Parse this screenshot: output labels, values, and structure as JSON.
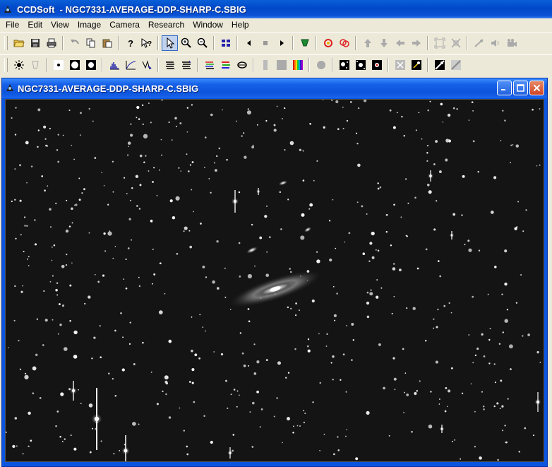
{
  "app": {
    "title": "CCDSoft  - NGC7331-AVERAGE-DDP-SHARP-C.SBIG",
    "icon": "ccdsoft-app-icon"
  },
  "menu": [
    "File",
    "Edit",
    "View",
    "Image",
    "Camera",
    "Research",
    "Window",
    "Help"
  ],
  "toolbar1": [
    {
      "icon": "open-folder-icon"
    },
    {
      "icon": "save-icon"
    },
    {
      "icon": "print-icon"
    },
    {
      "sep": true
    },
    {
      "icon": "undo-icon"
    },
    {
      "icon": "copy-icon"
    },
    {
      "icon": "paste-icon"
    },
    {
      "sep": true
    },
    {
      "icon": "help-icon"
    },
    {
      "icon": "context-help-icon"
    },
    {
      "sep": true
    },
    {
      "icon": "pointer-icon",
      "active": true
    },
    {
      "icon": "zoom-in-icon"
    },
    {
      "icon": "zoom-out-icon"
    },
    {
      "sep": true
    },
    {
      "icon": "tile-icon"
    },
    {
      "sep": true
    },
    {
      "icon": "prev-icon"
    },
    {
      "icon": "stop-icon"
    },
    {
      "icon": "next-icon"
    },
    {
      "sep": true
    },
    {
      "icon": "filter-icon"
    },
    {
      "sep": true
    },
    {
      "icon": "focus-icon"
    },
    {
      "icon": "focus2-icon"
    },
    {
      "sep": true
    },
    {
      "icon": "arrow-up-icon"
    },
    {
      "icon": "arrow-down-icon"
    },
    {
      "icon": "arrow-left-icon"
    },
    {
      "icon": "arrow-right-icon"
    },
    {
      "sep": true
    },
    {
      "icon": "fit-icon"
    },
    {
      "icon": "expand-icon"
    },
    {
      "sep": true
    },
    {
      "icon": "mute-icon"
    },
    {
      "icon": "speaker-icon"
    },
    {
      "icon": "camera-icon"
    }
  ],
  "toolbar2": [
    {
      "icon": "brightness-icon"
    },
    {
      "icon": "reduce-icon"
    },
    {
      "sep": true
    },
    {
      "icon": "star-small-icon"
    },
    {
      "icon": "star-medium-icon"
    },
    {
      "icon": "star-large-icon"
    },
    {
      "sep": true
    },
    {
      "icon": "histogram-icon"
    },
    {
      "icon": "curve-icon"
    },
    {
      "icon": "profile-icon"
    },
    {
      "sep": true
    },
    {
      "icon": "stack-icon"
    },
    {
      "icon": "stack2-icon"
    },
    {
      "sep": true
    },
    {
      "icon": "color-stack-icon"
    },
    {
      "icon": "color-stack2-icon"
    },
    {
      "icon": "color-stack3-icon"
    },
    {
      "sep": true
    },
    {
      "icon": "gray-block-icon"
    },
    {
      "icon": "gray-block2-icon"
    },
    {
      "icon": "rainbow-icon"
    },
    {
      "sep": true
    },
    {
      "icon": "circle-icon"
    },
    {
      "sep": true
    },
    {
      "icon": "star-field-icon"
    },
    {
      "icon": "star-field2-icon"
    },
    {
      "icon": "star-field3-icon"
    },
    {
      "sep": true
    },
    {
      "icon": "crosshair-icon"
    },
    {
      "icon": "sparkle-icon"
    },
    {
      "sep": true
    },
    {
      "icon": "diagonal-icon"
    },
    {
      "icon": "diagonal2-icon"
    }
  ],
  "child": {
    "title": "NGC7331-AVERAGE-DDP-SHARP-C.SBIG",
    "icon": "sbig-doc-icon"
  }
}
